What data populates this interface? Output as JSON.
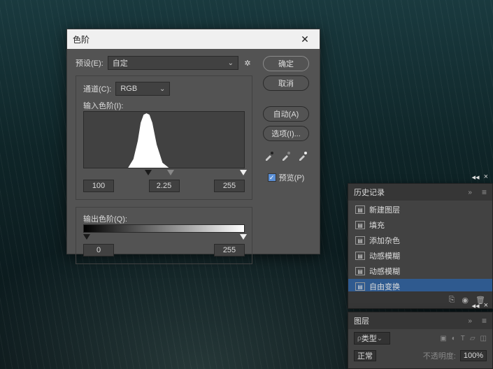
{
  "dialog": {
    "title": "色阶",
    "preset_label": "预设(E):",
    "preset_value": "自定",
    "channel_label": "通道(C):",
    "channel_value": "RGB",
    "input_label": "输入色阶(I):",
    "input_black": "100",
    "input_mid": "2.25",
    "input_white": "255",
    "output_label": "输出色阶(Q):",
    "output_black": "0",
    "output_white": "255",
    "ok": "确定",
    "cancel": "取消",
    "auto": "自动(A)",
    "options": "选项(I)...",
    "preview": "预览(P)"
  },
  "history": {
    "title": "历史记录",
    "items": [
      {
        "label": "新建图层"
      },
      {
        "label": "填充"
      },
      {
        "label": "添加杂色"
      },
      {
        "label": "动感模糊"
      },
      {
        "label": "动感模糊"
      },
      {
        "label": "自由变换"
      }
    ]
  },
  "layers": {
    "title": "图层",
    "filter": "类型",
    "mode": "正常",
    "opacity_label": "不透明度:",
    "opacity": "100%"
  }
}
